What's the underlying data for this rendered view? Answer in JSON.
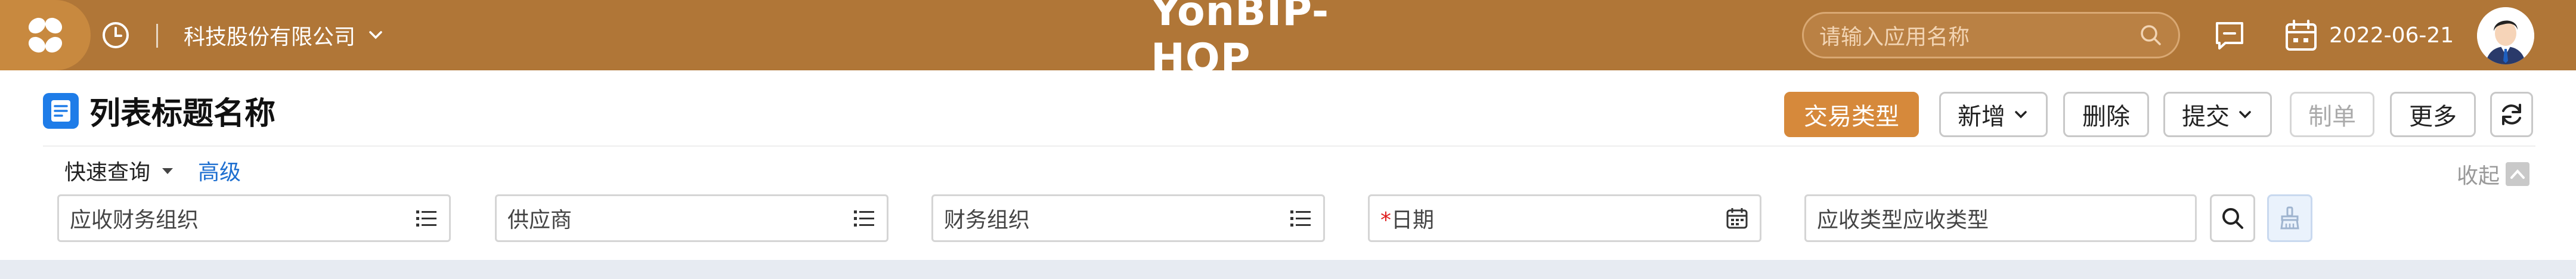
{
  "header": {
    "org_name": "科技股份有限公司",
    "brand": "YonBIP-HOP",
    "search_placeholder": "请输入应用名称",
    "date": "2022-06-21"
  },
  "page": {
    "title": "列表标题名称"
  },
  "toolbar": {
    "transaction_type": "交易类型",
    "add": "新增",
    "delete": "删除",
    "submit": "提交",
    "make": "制单",
    "more": "更多"
  },
  "query": {
    "quick_query": "快速查询",
    "advanced": "高级",
    "collapse": "收起",
    "fields": [
      {
        "label": "应收财务组织"
      },
      {
        "label": "供应商"
      },
      {
        "label": "财务组织"
      },
      {
        "label": "日期",
        "required_mark": "*"
      },
      {
        "label": "应收类型应收类型"
      }
    ]
  },
  "colors": {
    "header_bg": "#b07637",
    "primary_button": "#d6893b",
    "link": "#1e6fd0",
    "title_icon": "#1e7ce8"
  },
  "icons": [
    "app-logo-icon",
    "history-clock-icon",
    "chevron-down-icon",
    "search-icon",
    "message-icon",
    "calendar-icon",
    "avatar",
    "document-icon",
    "refresh-icon",
    "list-icon",
    "calendar-field-icon",
    "magnifier-icon",
    "clear-brush-icon",
    "collapse-up-icon"
  ]
}
